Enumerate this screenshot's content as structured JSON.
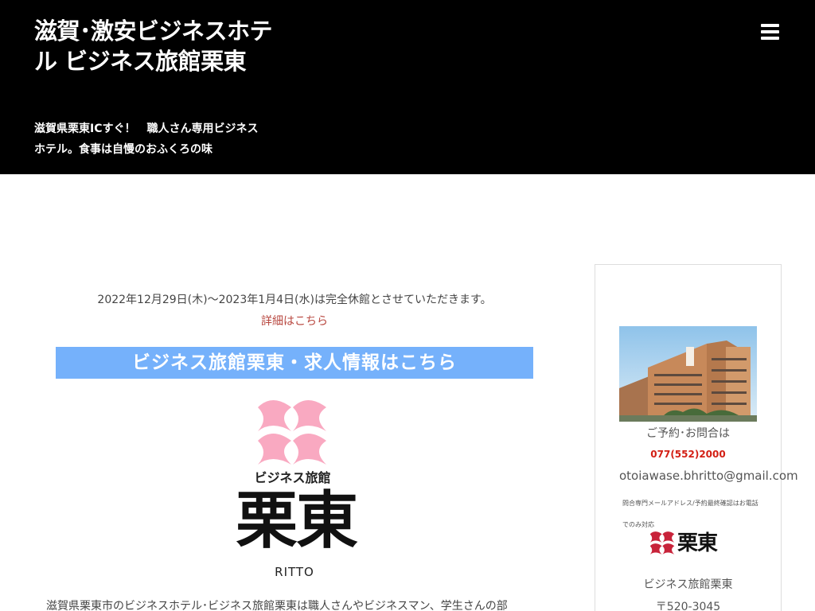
{
  "header": {
    "title": "滋賀･激安ビジネスホテル ビジネス旅館栗東",
    "tagline": "滋賀県栗東ICすぐ！　職人さん専用ビジネスホテル。食事は自慢のおふくろの味",
    "menu_icon": "hamburger-menu-icon"
  },
  "main": {
    "notice": "2022年12月29日(木)〜2023年1月4日(水)は完全休館とさせていただきます。",
    "notice_link": "詳細はこちら",
    "recruit_banner": "ビジネス旅館栗東・求人情報はこちら",
    "logo": {
      "small_text": "ビジネス旅館",
      "big_text": "栗東",
      "romaji": "RITTO",
      "mark_color": "#f9a9c1"
    },
    "intro": "滋賀県栗東市のビジネスホテル･ビジネス旅館栗東は職人さんやビジネスマン、学生さんの部"
  },
  "sidebar": {
    "photo_icon": "hotel-building-photo",
    "contact_heading": "ご予約･お問合は",
    "phone": "077(552)2000",
    "email": "otoiawase.bhritto@gmail.com",
    "note": "問合専門メールアドレス/予約最終確認はお電話でのみ対応",
    "logo_text": "栗東",
    "name": "ビジネス旅館栗東",
    "zip": "〒520-3045"
  },
  "colors": {
    "header_bg": "#000000",
    "banner_bg": "#75b1fb",
    "link": "#b8473f",
    "phone": "#d31f14",
    "logo_pink": "#f9a9c1",
    "side_logo_red": "#c8233a"
  }
}
